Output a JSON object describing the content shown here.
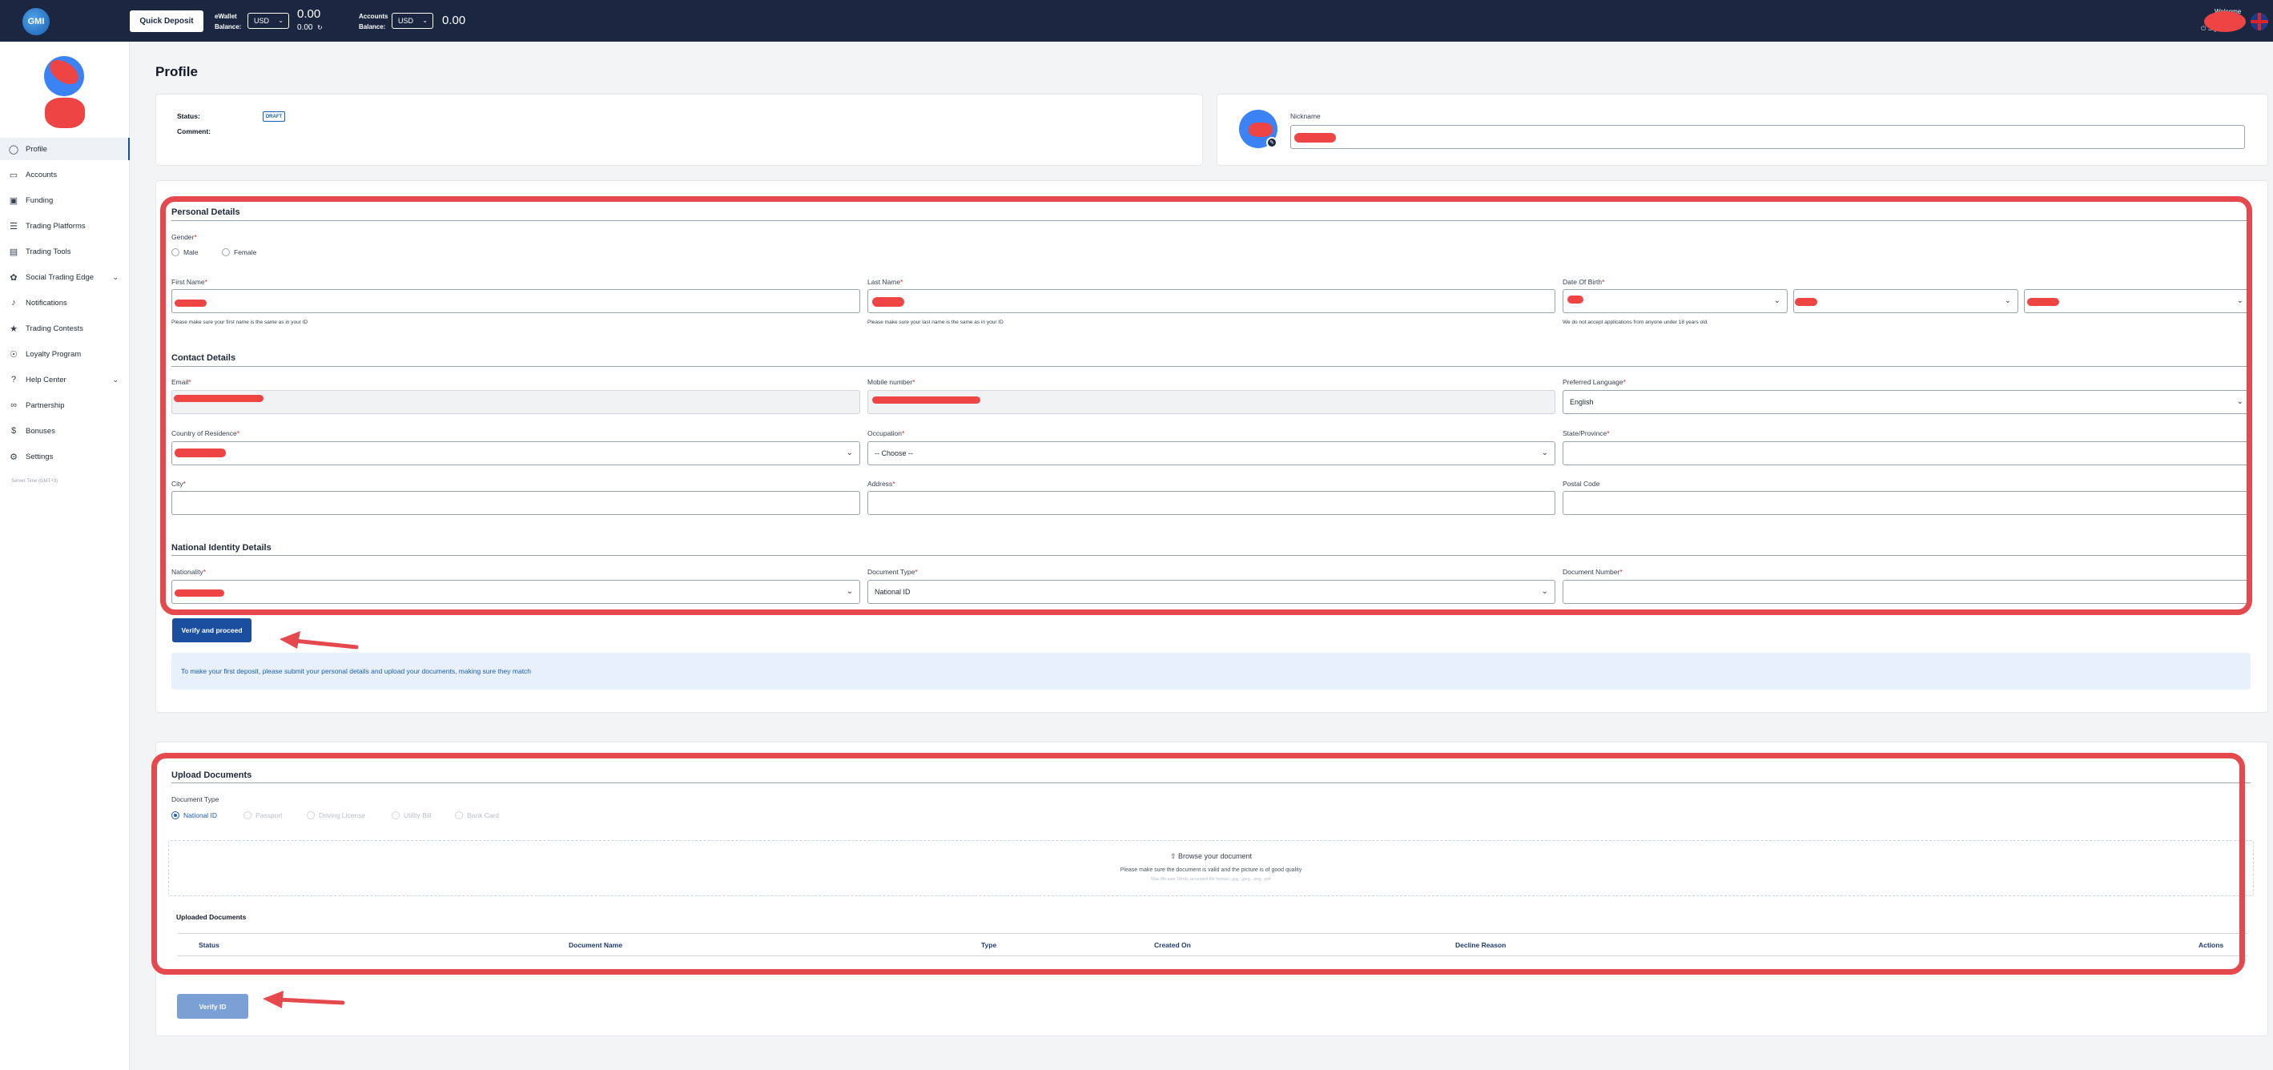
{
  "topbar": {
    "logo_text": "GMI",
    "quick_deposit_label": "Quick Deposit",
    "ewallet_label_line1": "eWallet",
    "ewallet_label_line2": "Balance:",
    "ewallet_currency": "USD",
    "ewallet_balance": "0.00",
    "ewallet_secondary": "0.00",
    "accounts_label_line1": "Accounts",
    "accounts_label_line2": "Balance:",
    "accounts_currency": "USD",
    "accounts_balance": "0.00",
    "welcome": "Welcome",
    "sign_out": "Sign Out"
  },
  "sidebar": {
    "items": [
      {
        "label": "Profile",
        "icon": "user-icon"
      },
      {
        "label": "Accounts",
        "icon": "card-icon"
      },
      {
        "label": "Funding",
        "icon": "wallet-icon"
      },
      {
        "label": "Trading Platforms",
        "icon": "layers-icon"
      },
      {
        "label": "Trading Tools",
        "icon": "toolbox-icon"
      },
      {
        "label": "Social Trading Edge",
        "icon": "network-icon"
      },
      {
        "label": "Notifications",
        "icon": "bell-icon"
      },
      {
        "label": "Trading Contests",
        "icon": "trophy-icon"
      },
      {
        "label": "Loyalty Program",
        "icon": "badge-icon"
      },
      {
        "label": "Help Center",
        "icon": "help-icon"
      },
      {
        "label": "Partnership",
        "icon": "handshake-icon"
      },
      {
        "label": "Bonuses",
        "icon": "dollar-icon"
      },
      {
        "label": "Settings",
        "icon": "gear-icon"
      }
    ],
    "server_time": "Server Time (GMT+3)"
  },
  "page": {
    "title": "Profile",
    "status_label": "Status:",
    "status_badge": "DRAFT",
    "comment_label": "Comment:",
    "nickname_label": "Nickname"
  },
  "personal": {
    "title": "Personal Details",
    "gender_label": "Gender",
    "male": "Male",
    "female": "Female",
    "first_name_label": "First Name",
    "first_name_hint": "Please make sure your first name is the same as in your ID",
    "last_name_label": "Last Name",
    "last_name_hint": "Please make sure your last name is the same as in your ID",
    "dob_label": "Date Of Birth",
    "dob_hint": "We do not accept applications from anyone under 18 years old."
  },
  "contact": {
    "title": "Contact Details",
    "email_label": "Email",
    "mobile_label": "Mobile number",
    "language_label": "Preferred Language",
    "language_value": "English",
    "country_label": "Country of Residence",
    "occupation_label": "Occupation",
    "occupation_value": "-- Choose --",
    "state_label": "State/Province",
    "city_label": "City",
    "address_label": "Address",
    "postal_label": "Postal Code"
  },
  "identity": {
    "title": "National Identity Details",
    "nationality_label": "Nationality",
    "doc_type_label": "Document Type",
    "doc_type_value": "National ID",
    "doc_number_label": "Document Number",
    "verify_button": "Verify and proceed",
    "info_text": "To make your first deposit, please submit your personal details and upload your documents, making sure they match"
  },
  "upload": {
    "title": "Upload Documents",
    "doc_type_label": "Document Type",
    "options": [
      "National ID",
      "Passport",
      "Driving License",
      "Utility Bill",
      "Bank Card"
    ],
    "browse": "Browse your document",
    "hint": "Please make sure the document is valid and the picture is of good quality",
    "hint2": "Max file size 10mb, accepted file format: .jpg, .jpeg, .png, .pdf",
    "uploaded_title": "Uploaded Documents",
    "columns": [
      "Status",
      "Document Name",
      "Type",
      "Created On",
      "Decline Reason",
      "Actions"
    ],
    "verify_id_button": "Verify ID"
  },
  "colors": {
    "topbar": "#1b2741",
    "primary": "#1a4fa0",
    "annotation": "#e5484d"
  }
}
